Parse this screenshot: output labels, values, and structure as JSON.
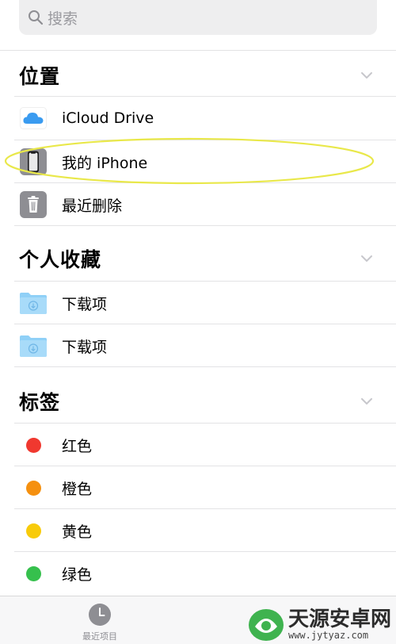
{
  "search": {
    "placeholder": "搜索"
  },
  "sections": {
    "locations": {
      "title": "位置",
      "items": [
        {
          "label": "iCloud Drive",
          "icon": "icloud-icon"
        },
        {
          "label": "我的 iPhone",
          "icon": "iphone-icon",
          "highlighted": true
        },
        {
          "label": "最近删除",
          "icon": "trash-icon"
        }
      ]
    },
    "favorites": {
      "title": "个人收藏",
      "items": [
        {
          "label": "下载项",
          "icon": "download-folder-icon"
        },
        {
          "label": "下载项",
          "icon": "download-folder-icon"
        }
      ]
    },
    "tags": {
      "title": "标签",
      "items": [
        {
          "label": "红色",
          "color": "#f0382f"
        },
        {
          "label": "橙色",
          "color": "#f5900f"
        },
        {
          "label": "黄色",
          "color": "#f8cb0a"
        },
        {
          "label": "绿色",
          "color": "#36c04d"
        }
      ]
    }
  },
  "tabbar": {
    "recent_label": "最近项目"
  },
  "watermark": {
    "name": "天源安卓网",
    "url": "www.jytyaz.com"
  },
  "colors": {
    "highlight_outline": "#e9e84a",
    "icloud_blue": "#3a9bf0",
    "folder_blue": "#8fd0f7"
  }
}
